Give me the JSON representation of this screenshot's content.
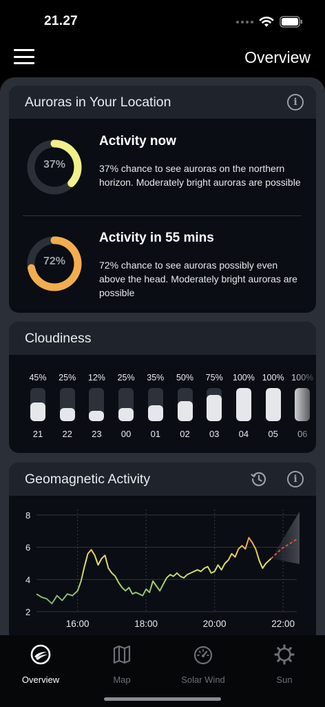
{
  "status_bar": {
    "time": "21.27"
  },
  "header": {
    "title": "Overview"
  },
  "aurora": {
    "title": "Auroras in Your Location",
    "now": {
      "percent": 37,
      "label": "37%",
      "title": "Activity now",
      "description": "37% chance to see auroras on the northern horizon. Moderately bright auroras are possible",
      "ring_color": "#f1f08a"
    },
    "later": {
      "percent": 72,
      "label": "72%",
      "title": "Activity in 55 mins",
      "description": "72% chance to see auroras possibly even above the head. Moderately bright auroras are possible",
      "ring_color": "#f2ad4e"
    }
  },
  "cloudiness": {
    "title": "Cloudiness",
    "hours": [
      {
        "percent": 45,
        "label": "45%",
        "hour": "21"
      },
      {
        "percent": 25,
        "label": "25%",
        "hour": "22"
      },
      {
        "percent": 12,
        "label": "12%",
        "hour": "23"
      },
      {
        "percent": 25,
        "label": "25%",
        "hour": "00"
      },
      {
        "percent": 35,
        "label": "35%",
        "hour": "01"
      },
      {
        "percent": 50,
        "label": "50%",
        "hour": "02"
      },
      {
        "percent": 75,
        "label": "75%",
        "hour": "03"
      },
      {
        "percent": 100,
        "label": "100%",
        "hour": "04"
      },
      {
        "percent": 100,
        "label": "100%",
        "hour": "05"
      },
      {
        "percent": 100,
        "label": "100%",
        "hour": "06"
      }
    ]
  },
  "geomagnetic": {
    "title": "Geomagnetic Activity",
    "chart_data": {
      "type": "line",
      "title": "",
      "xlabel": "",
      "ylabel": "",
      "y_ticks": [
        "8",
        "6",
        "4",
        "2"
      ],
      "x_ticks": [
        "16:00",
        "18:00",
        "20:00",
        "22:00"
      ],
      "ylim": [
        2,
        8
      ],
      "x_hour_range": [
        14.8,
        22.4
      ],
      "grid": true,
      "series": [
        {
          "x": [
            14.8,
            14.95,
            15.1,
            15.25,
            15.4,
            15.55,
            15.7,
            15.85,
            16.0,
            16.1,
            16.2,
            16.3,
            16.4,
            16.5,
            16.6,
            16.7,
            16.8,
            16.9,
            17.0,
            17.1,
            17.2,
            17.3,
            17.4,
            17.5,
            17.6,
            17.7,
            17.8,
            17.9,
            18.0,
            18.1,
            18.2,
            18.3,
            18.4,
            18.5,
            18.6,
            18.7,
            18.8,
            18.9,
            19.0,
            19.1,
            19.2,
            19.3,
            19.4,
            19.5,
            19.6,
            19.7,
            19.8,
            19.9,
            20.0,
            20.1,
            20.2,
            20.3,
            20.4,
            20.5,
            20.6,
            20.7,
            20.8,
            20.9,
            21.0,
            21.1,
            21.2,
            21.3,
            21.4,
            21.5,
            21.6,
            21.65
          ],
          "values": [
            3.1,
            2.9,
            2.8,
            2.5,
            3.0,
            2.7,
            3.1,
            3.0,
            3.3,
            3.9,
            4.8,
            5.6,
            5.85,
            5.5,
            4.9,
            5.3,
            5.5,
            4.7,
            4.4,
            4.2,
            3.8,
            3.5,
            3.3,
            3.5,
            3.1,
            3.2,
            3.1,
            3.0,
            3.4,
            3.2,
            3.9,
            3.6,
            3.3,
            3.7,
            4.1,
            4.3,
            4.2,
            4.4,
            4.2,
            4.1,
            4.3,
            4.4,
            4.5,
            4.6,
            4.5,
            4.7,
            4.8,
            4.4,
            4.5,
            4.9,
            4.6,
            5.0,
            5.2,
            5.6,
            5.4,
            5.9,
            6.1,
            5.9,
            6.6,
            6.3,
            5.9,
            5.2,
            4.7,
            5.0,
            5.2,
            5.3
          ]
        },
        {
          "name": "forecast",
          "x": [
            21.65,
            21.8,
            21.95,
            22.1,
            22.25,
            22.4
          ],
          "values": [
            5.3,
            5.6,
            5.9,
            6.1,
            6.3,
            6.5
          ]
        }
      ]
    }
  },
  "tabs": [
    {
      "label": "Overview",
      "icon": "aurora-overview-icon",
      "active": true
    },
    {
      "label": "Map",
      "icon": "map-icon",
      "active": false
    },
    {
      "label": "Solar Wind",
      "icon": "gauge-icon",
      "active": false
    },
    {
      "label": "Sun",
      "icon": "sun-gear-icon",
      "active": false
    }
  ]
}
